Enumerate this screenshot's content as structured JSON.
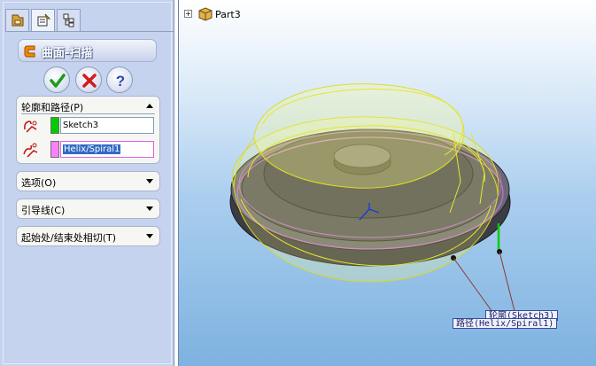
{
  "property_manager": {
    "tabs": [
      {
        "icon": "feature-manager-icon"
      },
      {
        "icon": "property-manager-icon"
      },
      {
        "icon": "configuration-manager-icon"
      }
    ],
    "feature_title": "曲面-扫描",
    "buttons": {
      "ok": "ok-check-icon",
      "cancel": "cancel-x-icon",
      "help": "help-question-icon"
    },
    "groups": {
      "profile_path": {
        "title": "轮廓和路径(P)",
        "expanded": true,
        "profile_value": "Sketch3",
        "profile_color": "#00cc00",
        "path_value": "Helix/Spiral1",
        "path_color": "#ff80ff"
      },
      "options": {
        "title": "选项(O)",
        "expanded": false
      },
      "guide_curves": {
        "title": "引导线(C)",
        "expanded": false
      },
      "tangency": {
        "title": "起始处/结束处相切(T)",
        "expanded": false
      }
    }
  },
  "viewport": {
    "tree_expand": "+",
    "tree_part_label": "Part3",
    "callouts": {
      "profile": "轮廓(Sketch3)",
      "path": "路径(Helix/Spiral1)"
    }
  }
}
